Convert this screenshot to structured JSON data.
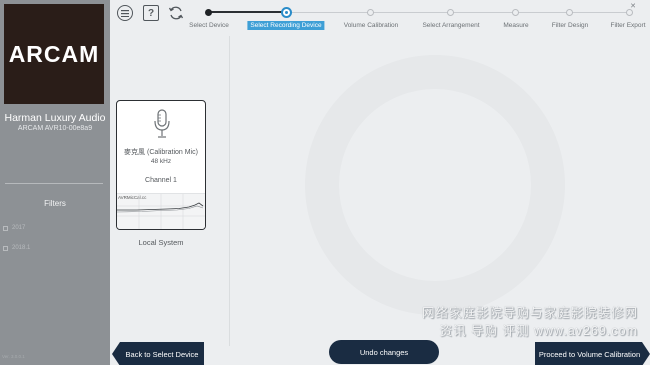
{
  "sidebar": {
    "logo_text": "ARCAM",
    "brand_name": "Harman Luxury Audio",
    "model": "ARCAM AVR10-00e8a9",
    "filters_title": "Filters",
    "filter_items": [
      "2017",
      "2018.1"
    ],
    "footer": "Ver. 3.0.0.1"
  },
  "toolbar": {
    "menu_icon": "menu-icon",
    "help_icon": "help-icon",
    "refresh_icon": "refresh-icon",
    "help_label": "?",
    "close_label": "✕"
  },
  "stepper": {
    "steps": [
      {
        "label": "Select Device",
        "state": "done"
      },
      {
        "label": "Select Recording Device",
        "state": "active"
      },
      {
        "label": "Volume Calibration",
        "state": "pending"
      },
      {
        "label": "Select Arrangement",
        "state": "pending"
      },
      {
        "label": "Measure",
        "state": "pending"
      },
      {
        "label": "Filter Design",
        "state": "pending"
      },
      {
        "label": "Filter Export",
        "state": "pending"
      }
    ]
  },
  "device_card": {
    "mic_name": "麥克風 (Calibration Mic)",
    "sample_rate": "48 kHz",
    "channel": "Channel 1",
    "graph_label": "AVRMicCal.cc",
    "caption": "Local System"
  },
  "buttons": {
    "back": "Back to Select Device",
    "undo": "Undo changes",
    "next": "Proceed to Volume Calibration"
  },
  "watermark": {
    "line1": "网络家庭影院导购与家庭影院装修网",
    "line2": "资讯 导购 评测  www.av269.com"
  },
  "colors": {
    "accent": "#3e9fd6",
    "button_bg": "#1a2c42",
    "sidebar_bg": "#8d9195"
  }
}
